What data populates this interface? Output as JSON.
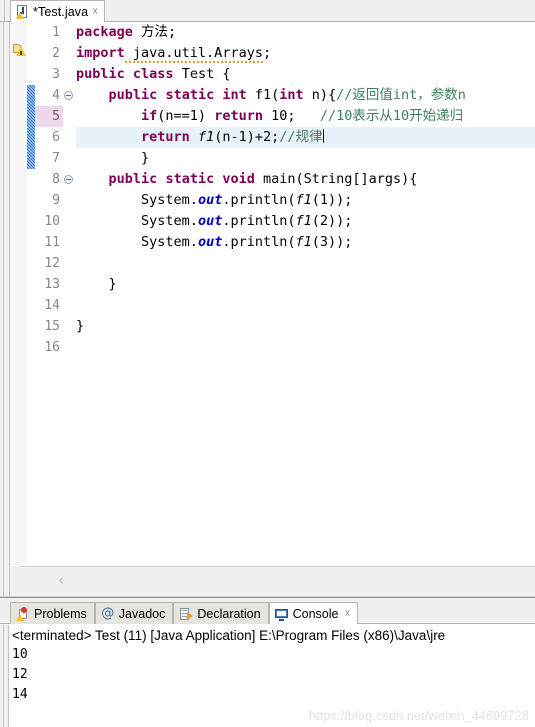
{
  "editor": {
    "tab": {
      "title": "*Test.java",
      "close_label": "☓",
      "icon": "java-file-warning-icon"
    },
    "scroll_left_arrow": "‹",
    "lines": [
      {
        "num": "1",
        "fold": false,
        "marker": null
      },
      {
        "num": "2",
        "fold": false,
        "marker": "warning"
      },
      {
        "num": "3",
        "fold": false,
        "marker": null
      },
      {
        "num": "4",
        "fold": true,
        "marker": null
      },
      {
        "num": "5",
        "fold": false,
        "marker": null
      },
      {
        "num": "6",
        "fold": false,
        "marker": null
      },
      {
        "num": "7",
        "fold": false,
        "marker": null
      },
      {
        "num": "8",
        "fold": true,
        "marker": null
      },
      {
        "num": "9",
        "fold": false,
        "marker": null
      },
      {
        "num": "10",
        "fold": false,
        "marker": null
      },
      {
        "num": "11",
        "fold": false,
        "marker": null
      },
      {
        "num": "12",
        "fold": false,
        "marker": null
      },
      {
        "num": "13",
        "fold": false,
        "marker": null
      },
      {
        "num": "14",
        "fold": false,
        "marker": null
      },
      {
        "num": "15",
        "fold": false,
        "marker": null
      },
      {
        "num": "16",
        "fold": false,
        "marker": null
      }
    ],
    "code_text": {
      "l1_package": "package",
      "l1_name": " 方法;",
      "l2_import": "import",
      "l2_pkg": " java.util.Arrays",
      "l2_semi": ";",
      "l3_public": "public",
      "l3_class": "class",
      "l3_rest": " Test {",
      "l4_indent": "    ",
      "l4_public": "public",
      "l4_static": "static",
      "l4_int": "int",
      "l4_sig": " f1(",
      "l4_int2": "int",
      "l4_sig2": " n){",
      "l4_comment": "//返回值int，参数n",
      "l5_indent": "        ",
      "l5_if": "if",
      "l5_cond": "(n==1) ",
      "l5_return": "return",
      "l5_val": " 10;   ",
      "l5_comment": "//10表示从10开始递归",
      "l6_indent": "        ",
      "l6_return": "return",
      "l6_f1": " f1",
      "l6_expr": "(n-1)+2;",
      "l6_comment": "//规律",
      "l7": "        }",
      "l8_indent": "    ",
      "l8_public": "public",
      "l8_static": "static",
      "l8_void": "void",
      "l8_rest": " main(String[]args){",
      "l9_indent": "        ",
      "l9_system": "System.",
      "l9_out": "out",
      "l9_print": ".println(",
      "l9_f1": "f1",
      "l9_arg": "(1));",
      "l10_f1_arg": "(2));",
      "l11_f1_arg": "(3));",
      "l13": "    }",
      "l15": "}"
    },
    "colors": {
      "keyword": "#7f0055",
      "comment": "#3f7f5f",
      "field": "#0000c0",
      "string": "#2a00ff",
      "current_line_bg": "#e8f2fb",
      "changebar": "#3a7fd5",
      "line_hl_pink": "#f0d8ec"
    }
  },
  "bottom": {
    "tabs": [
      {
        "label": "Problems",
        "icon": "problems-icon",
        "active": false,
        "closable": false
      },
      {
        "label": "Javadoc",
        "icon": "at-icon",
        "active": false,
        "closable": false
      },
      {
        "label": "Declaration",
        "icon": "declaration-icon",
        "active": false,
        "closable": false
      },
      {
        "label": "Console",
        "icon": "console-icon",
        "active": true,
        "closable": true
      }
    ],
    "close_label": "☓",
    "console": {
      "status": "<terminated> Test (11) [Java Application] E:\\Program Files (x86)\\Java\\jre",
      "output": [
        "10",
        "12",
        "14"
      ]
    }
  },
  "watermark": "https://blog.csdn.net/weixin_44699728"
}
